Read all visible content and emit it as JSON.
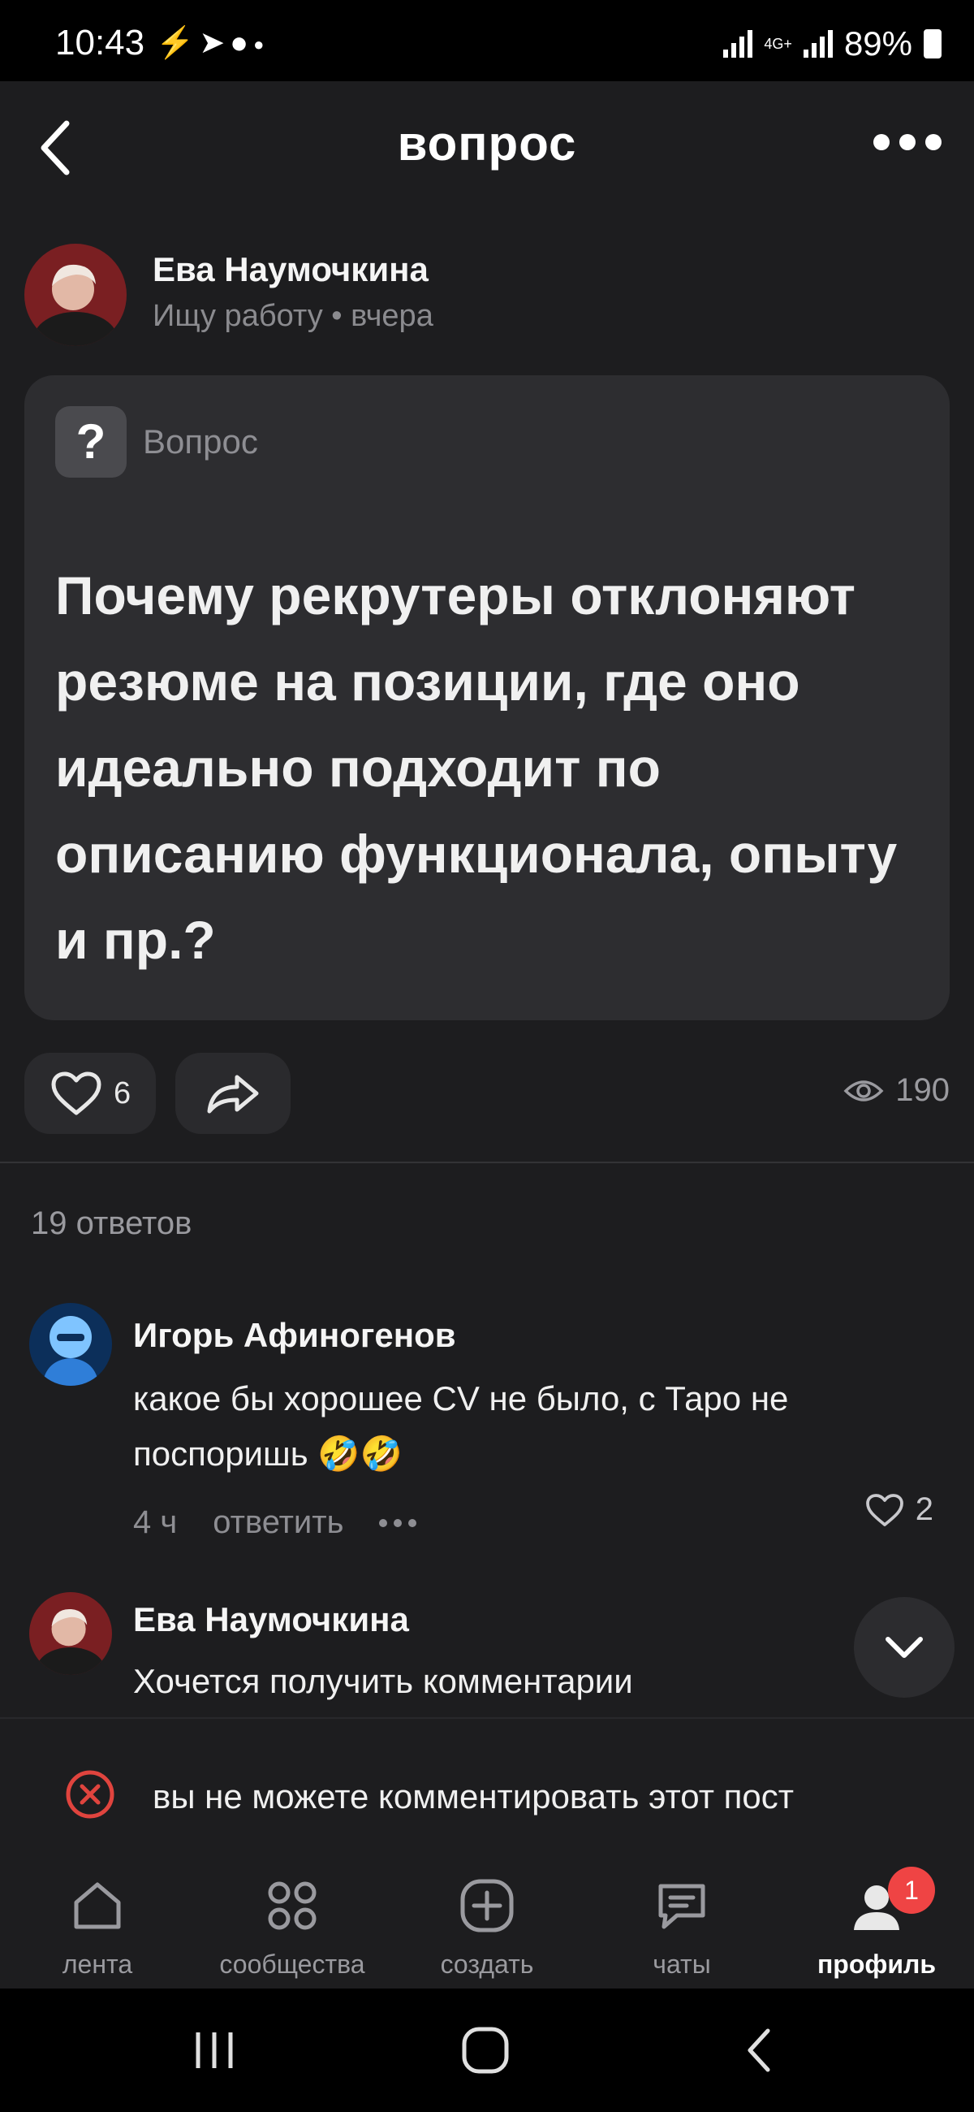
{
  "status_bar": {
    "time": "10:43",
    "left_icons": [
      "charging-icon",
      "telegram-icon",
      "account-icon",
      "dot"
    ],
    "network": "4G+",
    "battery": "89%"
  },
  "header": {
    "title": "вопрос",
    "back_icon": "chevron-left-icon",
    "menu_icon": "more-horizontal-icon"
  },
  "post": {
    "author": {
      "name": "Ева Наумочкина",
      "meta": "Ищу работу • вчера"
    },
    "card": {
      "badge": "?",
      "label": "Вопрос",
      "question": "Почему рекрутеры отклоняют резюме на позиции, где оно идеально подходит по описанию функционала, опыту и пр.?"
    },
    "likes": "6",
    "views": "190"
  },
  "answers": {
    "count_label": "19 ответов",
    "comments": [
      {
        "author": "Игорь Афиногенов",
        "text": "какое бы хорошее CV не было, с Таро не поспоришь 🤣🤣",
        "time": "4 ч",
        "reply": "ответить",
        "likes": "2"
      },
      {
        "author": "Ева Наумочкина",
        "text": "Хочется получить комментарии"
      }
    ]
  },
  "notice": {
    "text": "вы не можете комментировать этот пост"
  },
  "bottom_nav": {
    "items": [
      {
        "label": "лента",
        "icon": "home-icon"
      },
      {
        "label": "сообщества",
        "icon": "grid-icon"
      },
      {
        "label": "создать",
        "icon": "plus-square-icon"
      },
      {
        "label": "чаты",
        "icon": "chat-icon"
      },
      {
        "label": "профиль",
        "icon": "profile-icon"
      }
    ],
    "badge": "1"
  },
  "colors": {
    "background": "#1d1d1f",
    "card": "#2d2d30",
    "badge_red": "#ef4444",
    "muted": "#8e8e93"
  }
}
